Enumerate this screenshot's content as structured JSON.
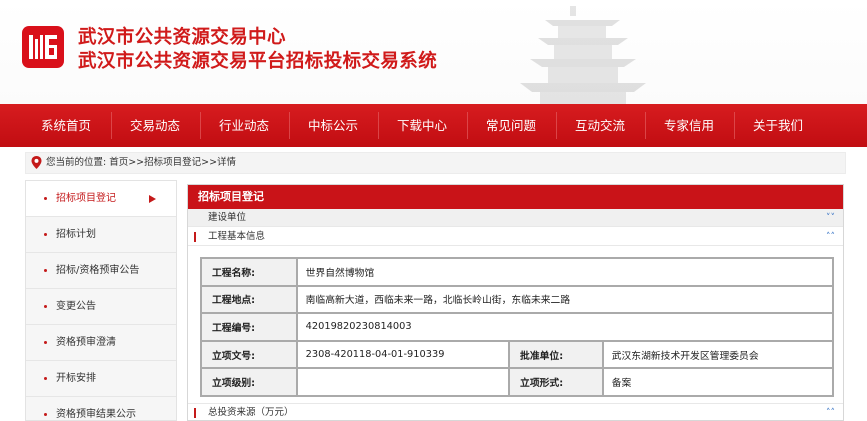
{
  "header": {
    "title_line1": "武汉市公共资源交易中心",
    "title_line2": "武汉市公共资源交易平台招标投标交易系统",
    "brand_color": "#d01a1a"
  },
  "nav": {
    "items": [
      "系统首页",
      "交易动态",
      "行业动态",
      "中标公示",
      "下载中心",
      "常见问题",
      "互动交流",
      "专家信用",
      "关于我们"
    ]
  },
  "breadcrumb": {
    "text": "您当前的位置: 首页>>招标项目登记>>详情"
  },
  "sidebar": {
    "items": [
      {
        "label": "招标项目登记",
        "active": true
      },
      {
        "label": "招标计划",
        "active": false
      },
      {
        "label": "招标/资格预审公告",
        "active": false
      },
      {
        "label": "变更公告",
        "active": false
      },
      {
        "label": "资格预审澄清",
        "active": false
      },
      {
        "label": "开标安排",
        "active": false
      },
      {
        "label": "资格预审结果公示",
        "active": false
      }
    ]
  },
  "panel": {
    "title": "招标项目登记",
    "sections": {
      "builder": "建设单位",
      "basic": "工程基本信息",
      "investment": "总投资来源（万元）"
    },
    "rows": [
      {
        "label": "工程名称:",
        "value": "世界自然博物馆"
      },
      {
        "label": "工程地点:",
        "value": "南临高新大道，西临未来一路，北临长岭山街，东临未来二路"
      },
      {
        "label": "工程编号:",
        "value": "42019820230814003"
      },
      {
        "label": "立项文号:",
        "value": "2308-420118-04-01-910339",
        "label2": "批准单位:",
        "value2": "武汉东湖新技术开发区管理委员会"
      },
      {
        "label": "立项级别:",
        "value": "",
        "label2": "立项形式:",
        "value2": "备案"
      }
    ]
  }
}
